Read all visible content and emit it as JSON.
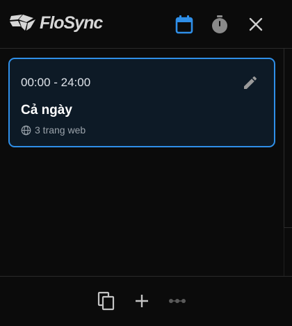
{
  "header": {
    "brand": "FloSync",
    "icons": {
      "logo": "flosync-logo-icon",
      "calendar": "calendar-icon",
      "timer": "timer-icon",
      "close": "close-icon"
    }
  },
  "schedule": {
    "items": [
      {
        "time_range": "00:00 - 24:00",
        "title": "Cả ngày",
        "sites_count": "3 trang web",
        "icons": {
          "edit": "pencil-icon",
          "sites": "globe-icon"
        }
      }
    ]
  },
  "footer": {
    "icons": {
      "copy": "copy-icon",
      "add": "plus-icon",
      "more": "more-dots-icon"
    }
  },
  "colors": {
    "accent": "#2f8fe8",
    "background": "#0b0b0b",
    "card_background": "#0d1a26",
    "text_primary": "#ffffff",
    "text_muted": "#9aa2aa"
  }
}
